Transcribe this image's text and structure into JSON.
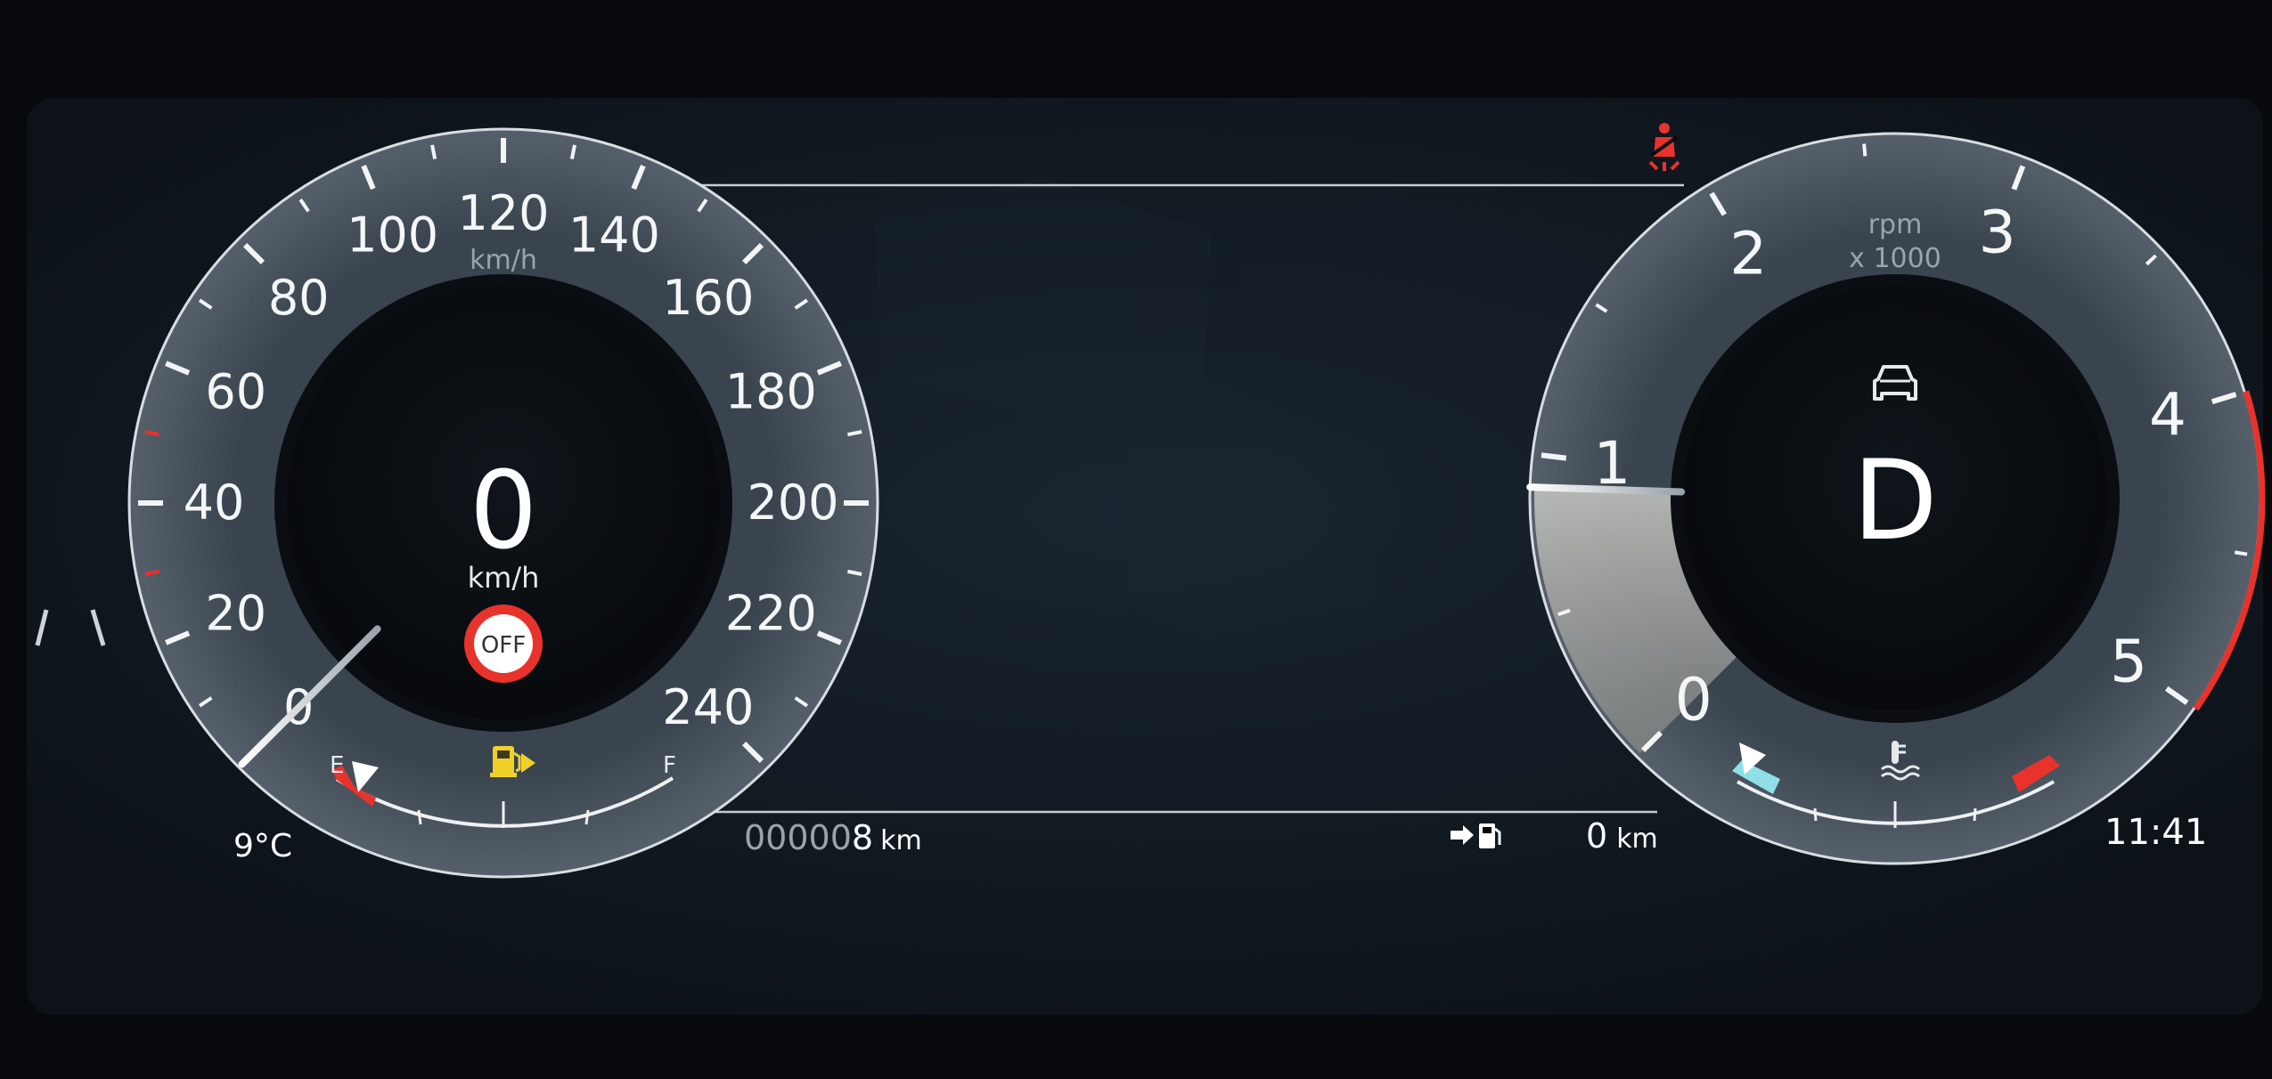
{
  "speedometer": {
    "scale_labels": [
      "0",
      "20",
      "40",
      "60",
      "80",
      "100",
      "120",
      "140",
      "160",
      "180",
      "200",
      "220",
      "240"
    ],
    "scale_min": 0,
    "scale_max": 240,
    "unit_label": "km/h",
    "needle_value": 0,
    "digital_speed": "0",
    "digital_unit": "km/h",
    "speed_limiter": "OFF"
  },
  "fuel_gauge": {
    "empty_label": "E",
    "full_label": "F",
    "level_fraction": 0.0,
    "icon": "fuel-pump-icon",
    "warning_color": "#f0d12a"
  },
  "tachometer": {
    "scale_labels": [
      "0",
      "1",
      "2",
      "3",
      "4",
      "5"
    ],
    "scale_min": 0,
    "scale_max": 5,
    "unit_label": "rpm",
    "multiplier_label": "x 1000",
    "needle_value": 0.9,
    "redline_start": 4.0,
    "gear": "D",
    "drive_mode_icon": "car-front-icon"
  },
  "coolant_gauge": {
    "icon": "coolant-temperature-icon",
    "cold_color": "#8fe0e6",
    "hot_color": "#e8322c",
    "level_fraction": 0.0
  },
  "status_bar": {
    "outside_temp": "9°C",
    "odometer_digits": "000008",
    "odometer_unit": "km",
    "range_icon": "fuel-range-icon",
    "range_value": "0",
    "range_unit": "km",
    "clock": "11:41"
  },
  "warnings": {
    "seatbelt_icon": "seatbelt-warning-icon",
    "seatbelt_color": "#e8322c",
    "lane_icon": "lane-assist-icon"
  },
  "colors": {
    "accent_red": "#e8322c",
    "fuel_yellow": "#f0d12a",
    "coolant_cyan": "#8fe0e6"
  }
}
